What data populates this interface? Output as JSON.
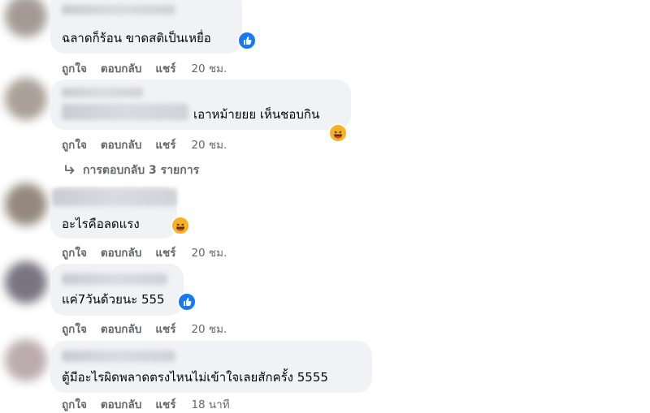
{
  "comments": [
    {
      "text": "ฉลาดก็ร้อน ขาดสติเป็นเหยื่อ",
      "reaction": "like-icon",
      "actions": {
        "like": "ถูกใจ",
        "reply": "ตอบกลับ",
        "share": "แชร์",
        "time": "20 ชม."
      }
    },
    {
      "text": "เอาหม้ายยย เห็นชอบกิน",
      "reaction": "haha-icon",
      "actions": {
        "like": "ถูกใจ",
        "reply": "ตอบกลับ",
        "share": "แชร์",
        "time": "20 ชม."
      },
      "replies_label": "การตอบกลับ 3 รายการ"
    },
    {
      "text": "อะไรคือลดแรง",
      "reaction": "haha-icon",
      "actions": {
        "like": "ถูกใจ",
        "reply": "ตอบกลับ",
        "share": "แชร์",
        "time": "20 ชม."
      }
    },
    {
      "text": "แค่7วันด้วยนะ 555",
      "reaction": "like-icon",
      "actions": {
        "like": "ถูกใจ",
        "reply": "ตอบกลับ",
        "share": "แชร์",
        "time": "20 ชม."
      }
    },
    {
      "text": "ตู้มีอะไรผิดพลาดตรงไหนไม่เข้าใจเลยสักครั้ง 5555",
      "reaction": "",
      "actions": {
        "like": "ถูกใจ",
        "reply": "ตอบกลับ",
        "share": "แชร์",
        "time": "18 นาที"
      }
    }
  ],
  "colors": {
    "bubble": "#f0f2f5",
    "meta": "#65676b",
    "like": "#1877f2",
    "haha": "#f7b125"
  }
}
